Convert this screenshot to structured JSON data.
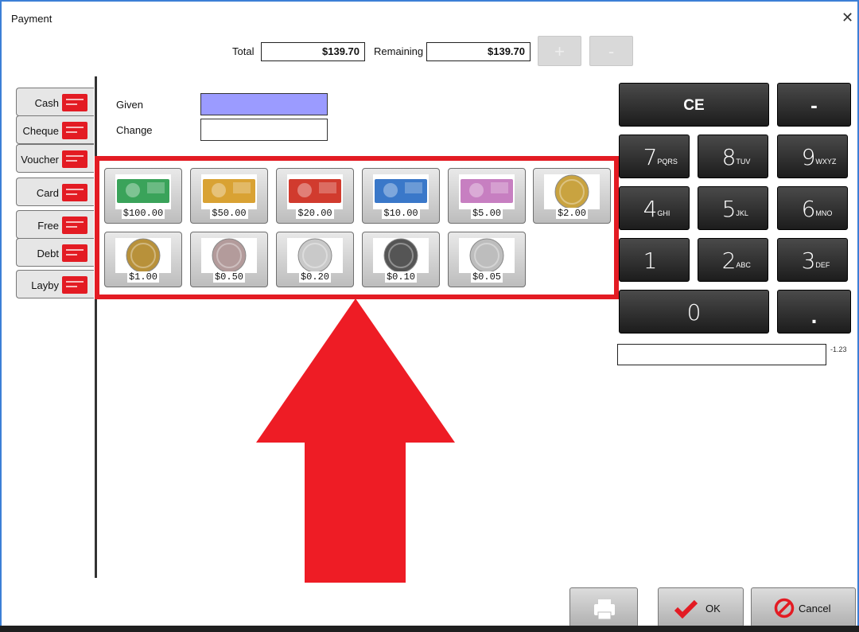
{
  "window": {
    "title": "Payment",
    "close_glyph": "✕"
  },
  "header": {
    "total_label": "Total",
    "total_value": "$139.70",
    "remaining_label": "Remaining",
    "remaining_value": "$139.70",
    "plus_label": "+",
    "minus_label": "-"
  },
  "tabs": [
    {
      "label": "Cash",
      "icon": "cash-flag-icon"
    },
    {
      "label": "Cheque",
      "icon": "cheque-card-icon"
    },
    {
      "label": "Voucher",
      "icon": "voucher-icon"
    },
    {
      "label": "Card",
      "icon": "credit-card-icon"
    },
    {
      "label": "Free",
      "icon": "free-icon"
    },
    {
      "label": "Debt",
      "icon": "debt-contact-icon"
    },
    {
      "label": "Layby",
      "icon": "layby-contact-icon"
    }
  ],
  "fields": {
    "given_label": "Given",
    "change_label": "Change",
    "given_value": "",
    "change_value": ""
  },
  "denominations": [
    {
      "label": "$100.00",
      "kind": "note",
      "color": "#3aa35a"
    },
    {
      "label": "$50.00",
      "kind": "note",
      "color": "#d9a233"
    },
    {
      "label": "$20.00",
      "kind": "note",
      "color": "#d13b2e"
    },
    {
      "label": "$10.00",
      "kind": "note",
      "color": "#3a78c9"
    },
    {
      "label": "$5.00",
      "kind": "note",
      "color": "#c77fc1"
    },
    {
      "label": "$2.00",
      "kind": "coin",
      "color": "#c9a340"
    },
    {
      "label": "$1.00",
      "kind": "coin",
      "color": "#b8913a"
    },
    {
      "label": "$0.50",
      "kind": "coin",
      "color": "#b39b9b"
    },
    {
      "label": "$0.20",
      "kind": "coin",
      "color": "#c9c9c9"
    },
    {
      "label": "$0.10",
      "kind": "coin",
      "color": "#555555"
    },
    {
      "label": "$0.05",
      "kind": "coin",
      "color": "#bdbdbd"
    }
  ],
  "keypad": {
    "ce": "CE",
    "minus": "-",
    "keys": [
      {
        "digit": "7",
        "letters": "PQRS"
      },
      {
        "digit": "8",
        "letters": "TUV"
      },
      {
        "digit": "9",
        "letters": "WXYZ"
      },
      {
        "digit": "4",
        "letters": "GHI"
      },
      {
        "digit": "5",
        "letters": "JKL"
      },
      {
        "digit": "6",
        "letters": "MNO"
      },
      {
        "digit": "1",
        "letters": ""
      },
      {
        "digit": "2",
        "letters": "ABC"
      },
      {
        "digit": "3",
        "letters": "DEF"
      }
    ],
    "zero": "0",
    "dot": "."
  },
  "entry": {
    "value": "",
    "note": "-1.23"
  },
  "buttons": {
    "print_icon": "printer-icon",
    "ok_label": "OK",
    "cancel_label": "Cancel"
  },
  "colors": {
    "accent": "#e31b23",
    "given_fill": "#9b9bff"
  }
}
